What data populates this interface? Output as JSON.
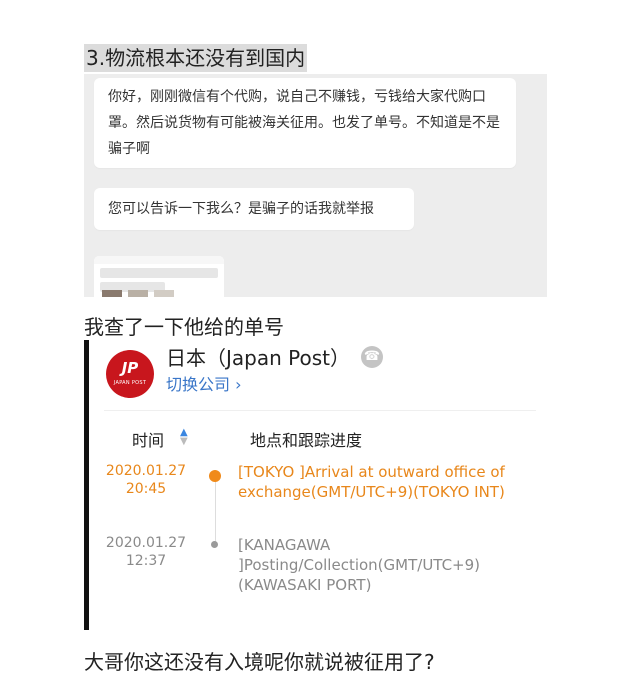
{
  "heading": "3.物流根本还没有到国内",
  "chat": {
    "bubble1": "你好，刚刚微信有个代购，说自己不赚钱，亏钱给大家代购口罩。然后说货物有可能被海关征用。也发了单号。不知道是不是骗子啊",
    "bubble2": "您可以告诉一下我么？是骗子的话我就举报"
  },
  "para2": "我查了一下他给的单号",
  "tracking": {
    "logo_mark": "JP",
    "logo_caption": "JAPAN POST",
    "carrier": "日本（Japan Post）",
    "switch": "切换公司 ›",
    "col_time": "时间",
    "col_location": "地点和跟踪进度",
    "events": [
      {
        "date": "2020.01.27",
        "time": "20:45",
        "text": "[TOKYO ]Arrival at outward office of exchange(GMT/UTC+9)(TOKYO INT)"
      },
      {
        "date": "2020.01.27",
        "time": "12:37",
        "text": "[KANAGAWA ]Posting/Collection(GMT/UTC+9)(KAWASAKI PORT)"
      }
    ]
  },
  "para3": "大哥你这还没有入境呢你就说被征用了?",
  "colors": {
    "accent_orange": "#e8871b",
    "link_blue": "#3a76c8",
    "jp_red": "#c8161d"
  }
}
